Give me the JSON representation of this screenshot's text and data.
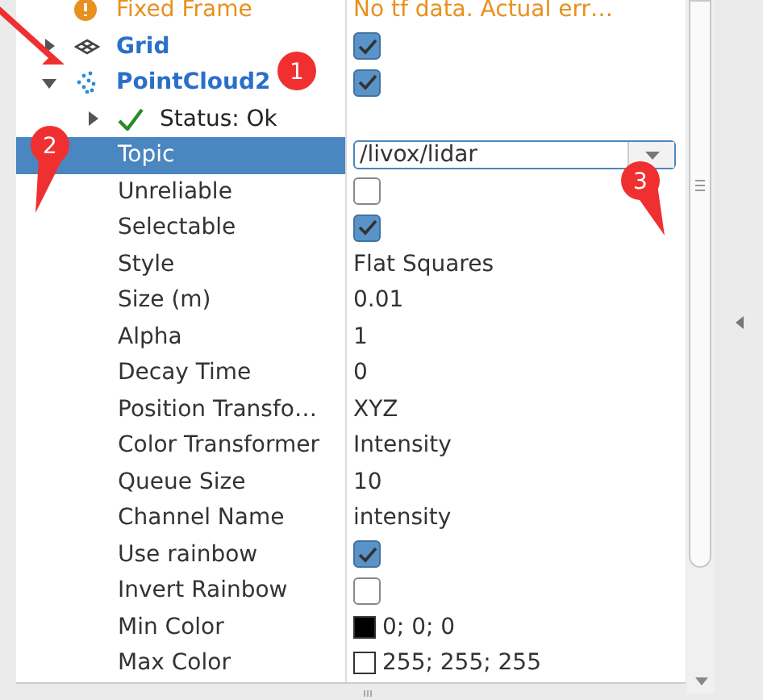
{
  "tree": [
    {
      "kind": "warning",
      "label": "Fixed Frame",
      "value": "No tf data.  Actual err…",
      "selected": false
    },
    {
      "kind": "grid",
      "label": "Grid",
      "expanded": false,
      "checked": true,
      "selected": false
    },
    {
      "kind": "pointcloud",
      "label": "PointCloud2",
      "expanded": true,
      "checked": true,
      "selected": false,
      "children": [
        {
          "kind": "ok",
          "label": "Status: Ok",
          "expanded": false,
          "selected": false
        },
        {
          "kind": "combo",
          "label": "Topic",
          "value": "/livox/lidar",
          "selected": true
        },
        {
          "kind": "checkbox",
          "label": "Unreliable",
          "checked": false,
          "selected": false
        },
        {
          "kind": "checkbox",
          "label": "Selectable",
          "checked": true,
          "selected": false
        },
        {
          "kind": "text",
          "label": "Style",
          "value": "Flat Squares",
          "selected": false
        },
        {
          "kind": "text",
          "label": "Size (m)",
          "value": "0.01",
          "selected": false
        },
        {
          "kind": "text",
          "label": "Alpha",
          "value": "1",
          "selected": false
        },
        {
          "kind": "text",
          "label": "Decay Time",
          "value": "0",
          "selected": false
        },
        {
          "kind": "text",
          "label": "Position Transfo…",
          "value": "XYZ",
          "selected": false
        },
        {
          "kind": "text",
          "label": "Color Transformer",
          "value": "Intensity",
          "selected": false
        },
        {
          "kind": "text",
          "label": "Queue Size",
          "value": "10",
          "selected": false
        },
        {
          "kind": "text",
          "label": "Channel Name",
          "value": "intensity",
          "selected": false
        },
        {
          "kind": "checkbox",
          "label": "Use rainbow",
          "checked": true,
          "selected": false
        },
        {
          "kind": "checkbox",
          "label": "Invert Rainbow",
          "checked": false,
          "selected": false
        },
        {
          "kind": "color",
          "label": "Min Color",
          "value": "0; 0; 0",
          "color": "#000000",
          "selected": false
        },
        {
          "kind": "color",
          "label": "Max Color",
          "value": "255; 255; 255",
          "color": "#ffffff",
          "selected": false
        }
      ]
    }
  ],
  "annotations": [
    {
      "label": "1"
    },
    {
      "label": "2"
    },
    {
      "label": "3"
    }
  ]
}
